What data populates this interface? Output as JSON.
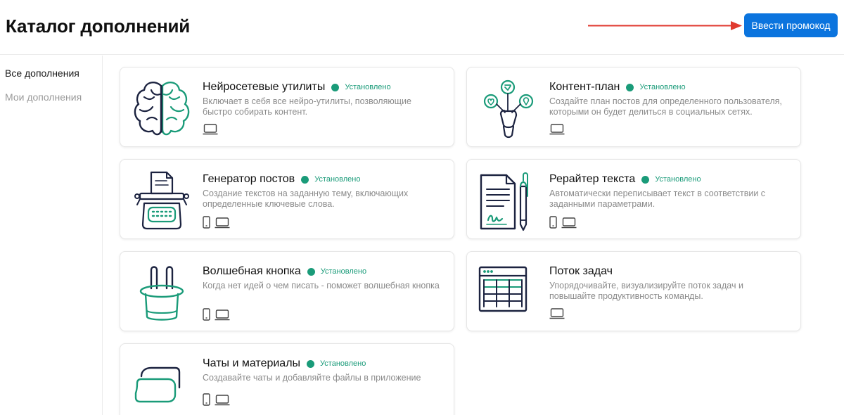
{
  "header": {
    "title": "Каталог дополнений",
    "promo_button": "Ввести промокод"
  },
  "sidebar": {
    "items": [
      {
        "label": "Все дополнения",
        "active": true
      },
      {
        "label": "Мои дополнения",
        "active": false
      }
    ]
  },
  "colors": {
    "accent_blue": "#0b74de",
    "installed_green": "#1a9b79",
    "arrow_red": "#e03a2f",
    "icon_dark": "#1c2340"
  },
  "cards": [
    {
      "title": "Нейросетевые утилиты",
      "status": "Установлено",
      "installed": true,
      "description": "Включает в себя все нейро-утилиты, позволяющие быстро собирать контент.",
      "devices": [
        "laptop-icon"
      ],
      "icon": "brain-icon"
    },
    {
      "title": "Контент-план",
      "status": "Установлено",
      "installed": true,
      "description": "Создайте план постов для определенного пользователя, которыми он будет делиться в социальных сетях.",
      "devices": [
        "laptop-icon"
      ],
      "icon": "content-plan-icon"
    },
    {
      "title": "Генератор постов",
      "status": "Установлено",
      "installed": true,
      "description": "Создание текстов на заданную тему, включающих определенные ключевые слова.",
      "devices": [
        "phone-icon",
        "laptop-icon"
      ],
      "icon": "typewriter-icon"
    },
    {
      "title": "Рерайтер текста",
      "status": "Установлено",
      "installed": true,
      "description": "Автоматически переписывает текст в соответствии с заданными параметрами.",
      "devices": [
        "phone-icon",
        "laptop-icon"
      ],
      "icon": "document-pen-icon"
    },
    {
      "title": "Волшебная кнопка",
      "status": "Установлено",
      "installed": true,
      "description": "Когда нет идей о чем писать - поможет волшебная кнопка",
      "devices": [
        "phone-icon",
        "laptop-icon"
      ],
      "icon": "magic-hat-icon"
    },
    {
      "title": "Поток задач",
      "status": "",
      "installed": false,
      "description": "Упорядочивайте, визуализируйте поток задач и повышайте продуктивность команды.",
      "devices": [
        "laptop-icon"
      ],
      "icon": "task-board-icon"
    },
    {
      "title": "Чаты и материалы",
      "status": "Установлено",
      "installed": true,
      "description": "Создавайте чаты и добавляйте файлы в приложение",
      "devices": [
        "phone-icon",
        "laptop-icon"
      ],
      "icon": "chat-bubbles-icon"
    }
  ]
}
